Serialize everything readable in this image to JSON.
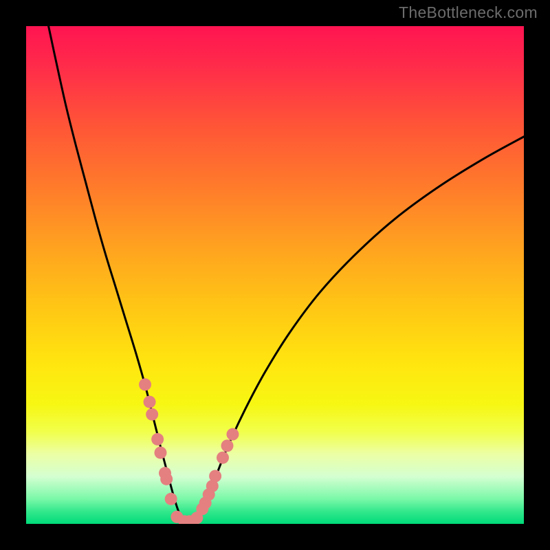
{
  "watermark": "TheBottleneck.com",
  "chart_data": {
    "type": "line",
    "title": "",
    "xlabel": "",
    "ylabel": "",
    "xlim": [
      0,
      100
    ],
    "ylim": [
      0,
      100
    ],
    "legend": false,
    "grid": false,
    "background_gradient": {
      "type": "vertical",
      "stops": [
        {
          "offset": 0.0,
          "color": "#ff1451"
        },
        {
          "offset": 0.08,
          "color": "#ff2b4a"
        },
        {
          "offset": 0.2,
          "color": "#ff5537"
        },
        {
          "offset": 0.32,
          "color": "#ff7a2b"
        },
        {
          "offset": 0.45,
          "color": "#ffa41f"
        },
        {
          "offset": 0.57,
          "color": "#ffc814"
        },
        {
          "offset": 0.68,
          "color": "#ffe60f"
        },
        {
          "offset": 0.76,
          "color": "#f7f713"
        },
        {
          "offset": 0.815,
          "color": "#f1ff4b"
        },
        {
          "offset": 0.86,
          "color": "#ecffa5"
        },
        {
          "offset": 0.905,
          "color": "#d4ffd1"
        },
        {
          "offset": 0.95,
          "color": "#7af8a8"
        },
        {
          "offset": 0.975,
          "color": "#32e88c"
        },
        {
          "offset": 1.0,
          "color": "#00db79"
        }
      ]
    },
    "series": [
      {
        "name": "bottleneck-curve",
        "color": "#000000",
        "x": [
          4.5,
          6,
          8,
          10,
          12,
          14,
          16,
          18,
          20,
          22,
          24,
          25.5,
          27,
          28.5,
          29.8,
          30.8,
          31.5,
          32,
          33,
          34,
          35,
          36.2,
          38,
          40.5,
          44,
          48,
          53,
          59,
          66,
          74,
          83,
          92,
          100
        ],
        "y": [
          100,
          93,
          84,
          76,
          68.5,
          61,
          54,
          47.5,
          41,
          34.5,
          27.5,
          21.5,
          15.5,
          9.8,
          5,
          2,
          0.5,
          0.4,
          0.45,
          0.6,
          1.8,
          4.3,
          9.2,
          15.5,
          23,
          30.5,
          38.5,
          46.5,
          54,
          61.2,
          67.8,
          73.4,
          77.8
        ]
      }
    ],
    "scatter_points": {
      "name": "highlighted-points",
      "color": "#e48080",
      "radius": 9,
      "x": [
        23.9,
        24.8,
        25.3,
        26.4,
        27.0,
        27.9,
        28.2,
        29.1,
        30.3,
        31.8,
        32.8,
        34.3,
        35.4,
        36.0,
        36.7,
        37.4,
        38.0,
        39.5,
        40.4,
        41.5
      ],
      "y": [
        28.0,
        24.5,
        22.0,
        17.0,
        14.3,
        10.2,
        9.0,
        5.0,
        1.4,
        0.5,
        0.5,
        1.2,
        3.0,
        4.2,
        5.9,
        7.6,
        9.6,
        13.3,
        15.7,
        18.0
      ]
    }
  }
}
